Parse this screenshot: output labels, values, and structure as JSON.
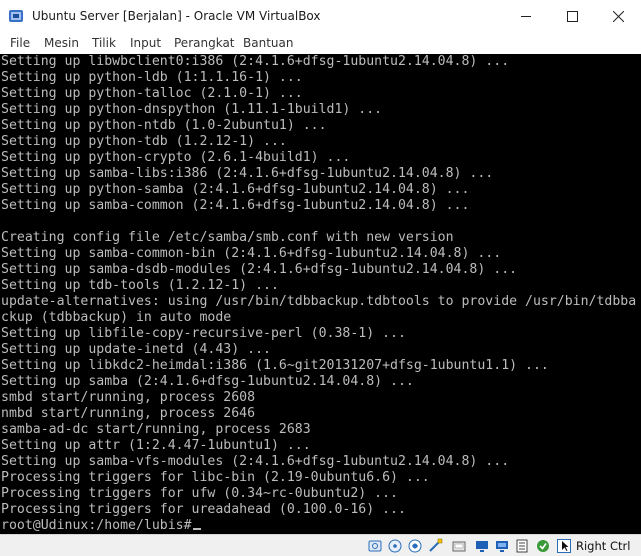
{
  "window": {
    "title": "Ubuntu Server  [Berjalan] - Oracle VM VirtualBox"
  },
  "menu": [
    "File",
    "Mesin",
    "Tilik",
    "Input",
    "Perangkat",
    "Bantuan"
  ],
  "console": {
    "lines": [
      "Setting up libwbclient0:i386 (2:4.1.6+dfsg-1ubuntu2.14.04.8) ...",
      "Setting up python-ldb (1:1.1.16-1) ...",
      "Setting up python-talloc (2.1.0-1) ...",
      "Setting up python-dnspython (1.11.1-1build1) ...",
      "Setting up python-ntdb (1.0-2ubuntu1) ...",
      "Setting up python-tdb (1.2.12-1) ...",
      "Setting up python-crypto (2.6.1-4build1) ...",
      "Setting up samba-libs:i386 (2:4.1.6+dfsg-1ubuntu2.14.04.8) ...",
      "Setting up python-samba (2:4.1.6+dfsg-1ubuntu2.14.04.8) ...",
      "Setting up samba-common (2:4.1.6+dfsg-1ubuntu2.14.04.8) ...",
      "",
      "Creating config file /etc/samba/smb.conf with new version",
      "Setting up samba-common-bin (2:4.1.6+dfsg-1ubuntu2.14.04.8) ...",
      "Setting up samba-dsdb-modules (2:4.1.6+dfsg-1ubuntu2.14.04.8) ...",
      "Setting up tdb-tools (1.2.12-1) ...",
      "update-alternatives: using /usr/bin/tdbbackup.tdbtools to provide /usr/bin/tdbba",
      "ckup (tdbbackup) in auto mode",
      "Setting up libfile-copy-recursive-perl (0.38-1) ...",
      "Setting up update-inetd (4.43) ...",
      "Setting up libkdc2-heimdal:i386 (1.6~git20131207+dfsg-1ubuntu1.1) ...",
      "Setting up samba (2:4.1.6+dfsg-1ubuntu2.14.04.8) ...",
      "smbd start/running, process 2608",
      "nmbd start/running, process 2646",
      "samba-ad-dc start/running, process 2683",
      "Setting up attr (1:2.4.47-1ubuntu1) ...",
      "Setting up samba-vfs-modules (2:4.1.6+dfsg-1ubuntu2.14.04.8) ...",
      "Processing triggers for libc-bin (2.19-0ubuntu6.6) ...",
      "Processing triggers for ufw (0.34~rc-0ubuntu2) ...",
      "Processing triggers for ureadahead (0.100.0-16) ...",
      "root@Udinux:/home/lubis#"
    ]
  },
  "status_icons": [
    "hard-disk-icon",
    "optical-drive-icon",
    "audio-icon",
    "network-icon",
    "usb-icon",
    "shared-folders-icon",
    "display-icon",
    "video-capture-icon",
    "cpu-icon",
    "mouse-integration-icon"
  ],
  "host_key": "Right Ctrl",
  "colors": {
    "console_bg": "#000000",
    "console_text": "#bcbcbc",
    "status_blue": "#2a6ebb"
  }
}
